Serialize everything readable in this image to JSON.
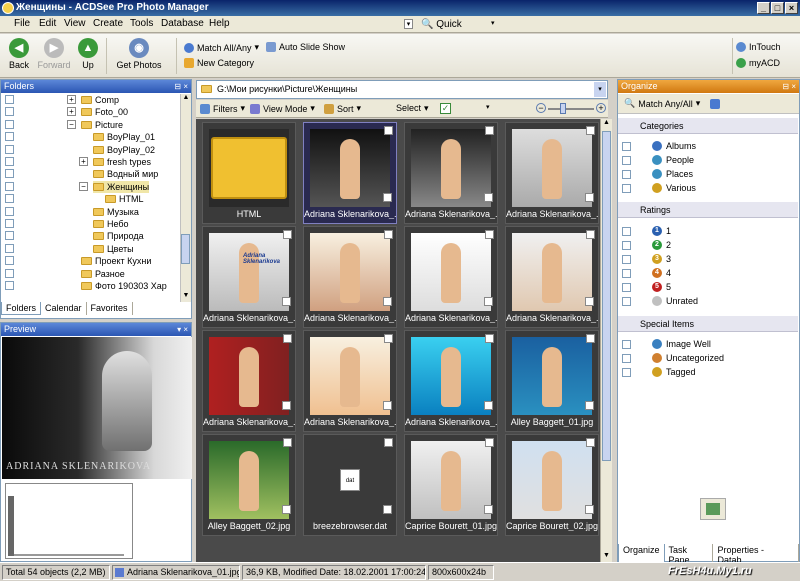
{
  "window": {
    "title": "Женщины - ACDSee Pro Photo Manager"
  },
  "menu": {
    "items": [
      "File",
      "Edit",
      "View",
      "Create",
      "Tools",
      "Database",
      "Help"
    ],
    "quick_search": "Quick Search"
  },
  "toolbar": {
    "back": "Back",
    "forward": "Forward",
    "up": "Up",
    "get_photos": "Get Photos",
    "match_all_any": "Match All/Any",
    "auto_slide_show": "Auto Slide Show",
    "new_category": "New Category",
    "intouch": "InTouch",
    "myacd": "myACD"
  },
  "folders": {
    "title": "Folders",
    "items": [
      "Comp",
      "Foto_00",
      "Picture",
      "BoyPlay_01",
      "BoyPlay_02",
      "fresh types",
      "Водный мир",
      "Женщины",
      "HTML",
      "Музыка",
      "Небо",
      "Природа",
      "Цветы",
      "Проект Кухни",
      "Разное",
      "Фото 190303 Хар"
    ],
    "tabs": [
      "Folders",
      "Calendar",
      "Favorites"
    ]
  },
  "preview": {
    "title": "Preview",
    "caption": "ADRIANA SKLENARIKOVA"
  },
  "browser": {
    "path": "G:\\Мои рисунки\\Picture\\Женщины",
    "filters": "Filters",
    "view_mode": "View Mode",
    "sort": "Sort",
    "select": "Select",
    "thumbs": [
      "HTML",
      "Adriana Sklenarikova_...",
      "Adriana Sklenarikova_...",
      "Adriana Sklenarikova_...",
      "Adriana Sklenarikova_...",
      "Adriana Sklenarikova_...",
      "Adriana Sklenarikova_...",
      "Adriana Sklenarikova_...",
      "Adriana Sklenarikova_...",
      "Adriana Sklenarikova_...",
      "Adriana Sklenarikova_...",
      "Alley Baggett_01.jpg",
      "Alley Baggett_02.jpg",
      "breezebrowser.dat",
      "Caprice Bourett_01.jpg",
      "Caprice Bourett_02.jpg"
    ],
    "thumb_label_adriana": "Adriana Sklenarikova",
    "thumb_label_dat": "dat"
  },
  "organize": {
    "title": "Organize",
    "match": "Match Any/All",
    "categories_title": "Categories",
    "categories": [
      "Albums",
      "People",
      "Places",
      "Various"
    ],
    "ratings_title": "Ratings",
    "ratings": [
      "1",
      "2",
      "3",
      "4",
      "5",
      "Unrated"
    ],
    "special_title": "Special Items",
    "special": [
      "Image Well",
      "Uncategorized",
      "Tagged"
    ],
    "tabs": [
      "Organize",
      "Task Pane",
      "Properties - Datab..."
    ]
  },
  "status": {
    "total": "Total 54 objects  (2,2 MB)",
    "file": "Adriana Sklenarikova_01.jpg",
    "info": "36,9 KB, Modified Date: 18.02.2001 17:00:24",
    "dims": "800x600x24b",
    "watermark": "FrEsH4u.My1.ru"
  }
}
